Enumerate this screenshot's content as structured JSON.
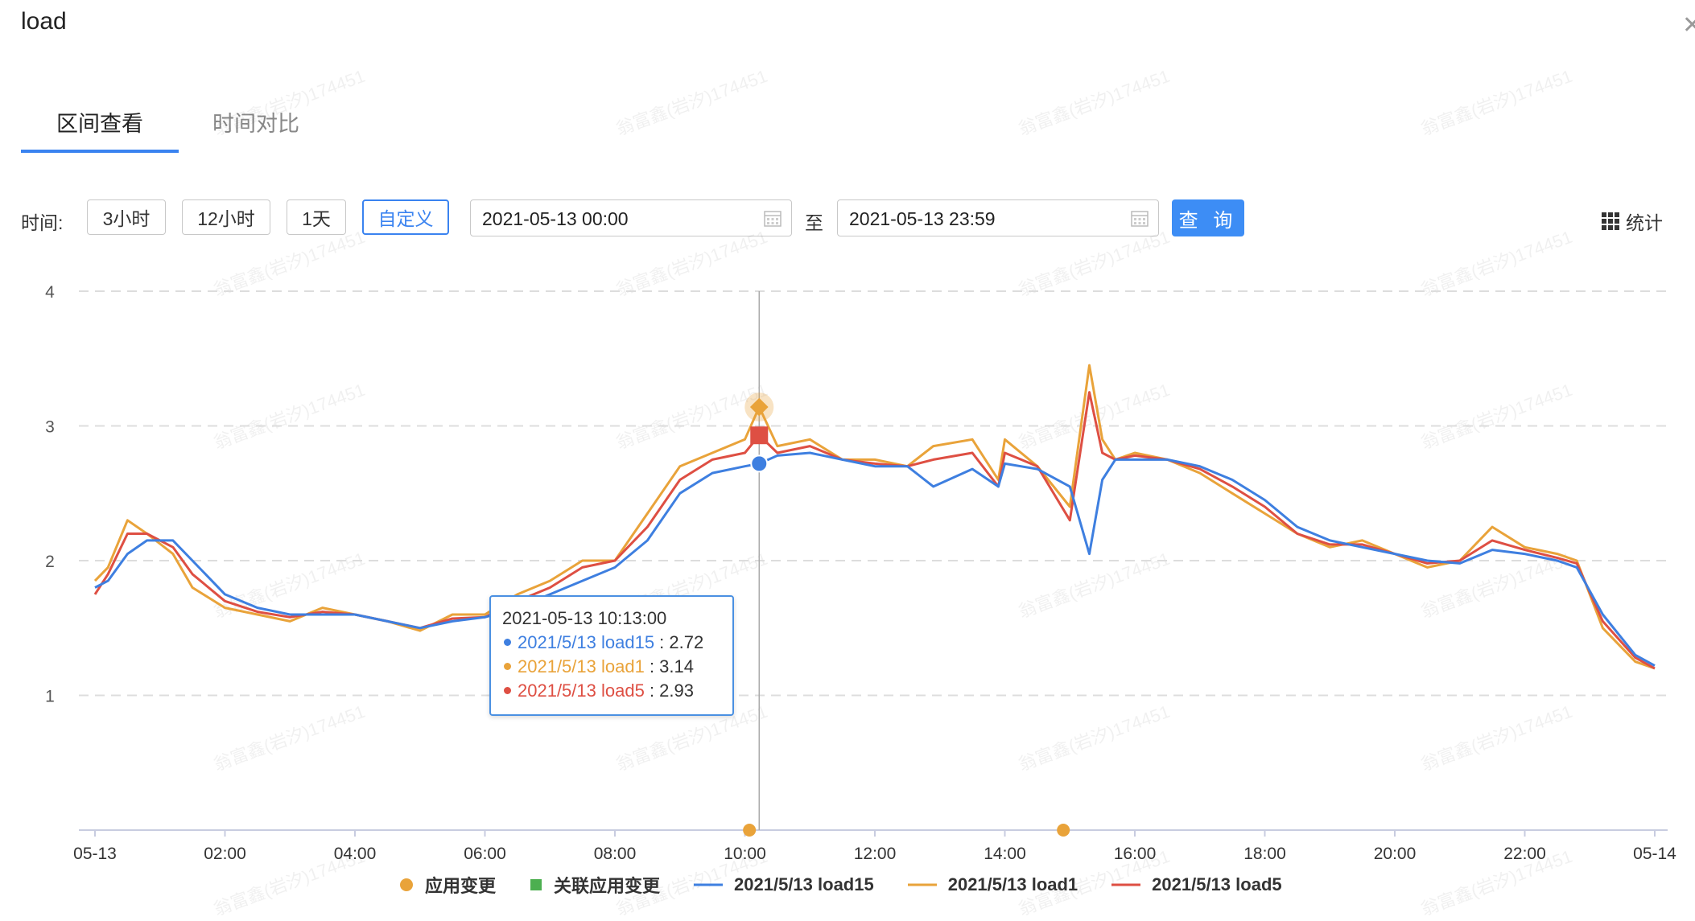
{
  "window": {
    "title": "load"
  },
  "tabs": [
    {
      "label": "区间查看",
      "active": true
    },
    {
      "label": "时间对比",
      "active": false
    }
  ],
  "toolbar": {
    "time_label": "时间:",
    "ranges": [
      "3小时",
      "12小时",
      "1天",
      "自定义"
    ],
    "selected_range": "自定义",
    "start": "2021-05-13 00:00",
    "separator": "至",
    "end": "2021-05-13 23:59",
    "query_label": "查 询",
    "stats_label": "统计"
  },
  "watermark": "翁富鑫(岩汐)174451",
  "tooltip": {
    "time": "2021-05-13 10:13:00",
    "rows": [
      {
        "name": "2021/5/13 load15",
        "value": "2.72",
        "color": "#3e7fe0"
      },
      {
        "name": "2021/5/13 load1",
        "value": "3.14",
        "color": "#e9a33a"
      },
      {
        "name": "2021/5/13 load5",
        "value": "2.93",
        "color": "#de4f43"
      }
    ]
  },
  "legend": [
    {
      "label": "应用变更",
      "type": "circle",
      "color": "#e9a33a"
    },
    {
      "label": "关联应用变更",
      "type": "square",
      "color": "#4caf50"
    },
    {
      "label": "2021/5/13 load15",
      "type": "line",
      "color": "#3e7fe0"
    },
    {
      "label": "2021/5/13 load1",
      "type": "line",
      "color": "#e9a33a"
    },
    {
      "label": "2021/5/13 load5",
      "type": "line",
      "color": "#de4f43"
    }
  ],
  "chart_data": {
    "type": "line",
    "x_ticks": [
      "05-13",
      "02:00",
      "04:00",
      "06:00",
      "08:00",
      "10:00",
      "12:00",
      "14:00",
      "16:00",
      "18:00",
      "20:00",
      "22:00",
      "05-14"
    ],
    "y_ticks": [
      "1",
      "2",
      "3",
      "4"
    ],
    "ylim": [
      0,
      4
    ],
    "xlim_hours": [
      0,
      24
    ],
    "grid": "dashed horizontal",
    "cursor_hour": 10.22,
    "change_events_hours": [
      10.07,
      14.9
    ],
    "series": [
      {
        "name": "2021/5/13 load15",
        "color": "#3e7fe0",
        "x": [
          0,
          0.2,
          0.5,
          0.8,
          1.2,
          1.5,
          2.0,
          2.5,
          3.0,
          3.5,
          4.0,
          4.5,
          5.0,
          5.5,
          6.0,
          6.5,
          7.0,
          7.5,
          8.0,
          8.5,
          9.0,
          9.5,
          10.0,
          10.22,
          10.5,
          11.0,
          11.5,
          12.0,
          12.5,
          12.9,
          13.5,
          13.9,
          14.0,
          14.5,
          15.0,
          15.3,
          15.5,
          15.7,
          16.0,
          16.5,
          17.0,
          17.5,
          18.0,
          18.5,
          19.0,
          19.5,
          20.0,
          20.5,
          21.0,
          21.5,
          22.0,
          22.5,
          22.8,
          23.2,
          23.7,
          24.0
        ],
        "y": [
          1.8,
          1.85,
          2.05,
          2.15,
          2.15,
          2.0,
          1.75,
          1.65,
          1.6,
          1.6,
          1.6,
          1.55,
          1.5,
          1.55,
          1.58,
          1.65,
          1.75,
          1.85,
          1.95,
          2.15,
          2.5,
          2.65,
          2.7,
          2.72,
          2.78,
          2.8,
          2.75,
          2.7,
          2.7,
          2.55,
          2.68,
          2.55,
          2.72,
          2.68,
          2.55,
          2.05,
          2.6,
          2.75,
          2.75,
          2.75,
          2.7,
          2.6,
          2.45,
          2.25,
          2.15,
          2.1,
          2.05,
          2.0,
          1.98,
          2.08,
          2.05,
          2.0,
          1.95,
          1.6,
          1.3,
          1.22
        ]
      },
      {
        "name": "2021/5/13 load1",
        "color": "#e9a33a",
        "x": [
          0,
          0.2,
          0.5,
          0.8,
          1.2,
          1.5,
          2.0,
          2.5,
          3.0,
          3.5,
          4.0,
          4.5,
          5.0,
          5.5,
          6.0,
          6.5,
          7.0,
          7.5,
          8.0,
          8.5,
          9.0,
          9.5,
          10.0,
          10.22,
          10.5,
          11.0,
          11.5,
          12.0,
          12.5,
          12.9,
          13.5,
          13.9,
          14.0,
          14.5,
          15.0,
          15.3,
          15.5,
          15.7,
          16.0,
          16.5,
          17.0,
          17.5,
          18.0,
          18.5,
          19.0,
          19.5,
          20.0,
          20.5,
          21.0,
          21.5,
          22.0,
          22.5,
          22.8,
          23.2,
          23.7,
          24.0
        ],
        "y": [
          1.85,
          1.95,
          2.3,
          2.2,
          2.05,
          1.8,
          1.65,
          1.6,
          1.55,
          1.65,
          1.6,
          1.55,
          1.48,
          1.6,
          1.6,
          1.75,
          1.85,
          2.0,
          2.0,
          2.35,
          2.7,
          2.8,
          2.9,
          3.14,
          2.85,
          2.9,
          2.75,
          2.75,
          2.7,
          2.85,
          2.9,
          2.6,
          2.9,
          2.7,
          2.4,
          3.45,
          2.9,
          2.75,
          2.8,
          2.75,
          2.65,
          2.5,
          2.35,
          2.2,
          2.1,
          2.15,
          2.05,
          1.95,
          2.0,
          2.25,
          2.1,
          2.05,
          2.0,
          1.5,
          1.25,
          1.2
        ]
      },
      {
        "name": "2021/5/13 load5",
        "color": "#de4f43",
        "x": [
          0,
          0.2,
          0.5,
          0.8,
          1.2,
          1.5,
          2.0,
          2.5,
          3.0,
          3.5,
          4.0,
          4.5,
          5.0,
          5.5,
          6.0,
          6.5,
          7.0,
          7.5,
          8.0,
          8.5,
          9.0,
          9.5,
          10.0,
          10.22,
          10.5,
          11.0,
          11.5,
          12.0,
          12.5,
          12.9,
          13.5,
          13.9,
          14.0,
          14.5,
          15.0,
          15.3,
          15.5,
          15.7,
          16.0,
          16.5,
          17.0,
          17.5,
          18.0,
          18.5,
          19.0,
          19.5,
          20.0,
          20.5,
          21.0,
          21.5,
          22.0,
          22.5,
          22.8,
          23.2,
          23.7,
          24.0
        ],
        "y": [
          1.75,
          1.9,
          2.2,
          2.2,
          2.1,
          1.9,
          1.7,
          1.62,
          1.58,
          1.62,
          1.6,
          1.55,
          1.5,
          1.57,
          1.58,
          1.7,
          1.8,
          1.95,
          2.0,
          2.25,
          2.6,
          2.75,
          2.8,
          2.93,
          2.8,
          2.85,
          2.75,
          2.72,
          2.7,
          2.75,
          2.8,
          2.55,
          2.8,
          2.7,
          2.3,
          3.25,
          2.8,
          2.75,
          2.78,
          2.75,
          2.68,
          2.55,
          2.4,
          2.2,
          2.12,
          2.12,
          2.05,
          1.98,
          2.0,
          2.15,
          2.08,
          2.02,
          1.98,
          1.55,
          1.28,
          1.2
        ]
      }
    ]
  }
}
